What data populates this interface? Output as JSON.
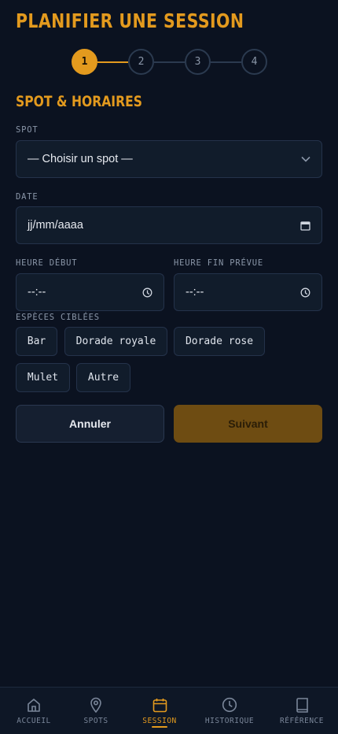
{
  "header": {
    "title": "PLANIFIER UNE SESSION"
  },
  "stepper": {
    "steps": [
      "1",
      "2",
      "3",
      "4"
    ],
    "current": 1
  },
  "section": {
    "title": "SPOT & HORAIRES"
  },
  "form": {
    "spot": {
      "label": "SPOT",
      "value": "— Choisir un spot —"
    },
    "date": {
      "label": "DATE",
      "value": "jj/mm/aaaa"
    },
    "start_time": {
      "label": "HEURE DÉBUT",
      "value": "--:--"
    },
    "end_time": {
      "label": "HEURE FIN PRÉVUE",
      "value": "--:--"
    },
    "species": {
      "label": "ESPÈCES CIBLÉES",
      "options": [
        "Bar",
        "Dorade royale",
        "Dorade rose",
        "Mulet",
        "Autre"
      ]
    }
  },
  "actions": {
    "cancel": "Annuler",
    "next": "Suivant"
  },
  "bottom_nav": {
    "items": [
      {
        "label": "ACCUEIL",
        "icon": "home-icon"
      },
      {
        "label": "SPOTS",
        "icon": "map-pin-icon"
      },
      {
        "label": "SESSION",
        "icon": "calendar-icon",
        "active": true
      },
      {
        "label": "HISTORIQUE",
        "icon": "clock-icon"
      },
      {
        "label": "RÉFÉRENCE",
        "icon": "book-icon"
      }
    ]
  },
  "colors": {
    "accent": "#e39a1e",
    "background": "#0b1220",
    "surface": "#111c2b"
  }
}
